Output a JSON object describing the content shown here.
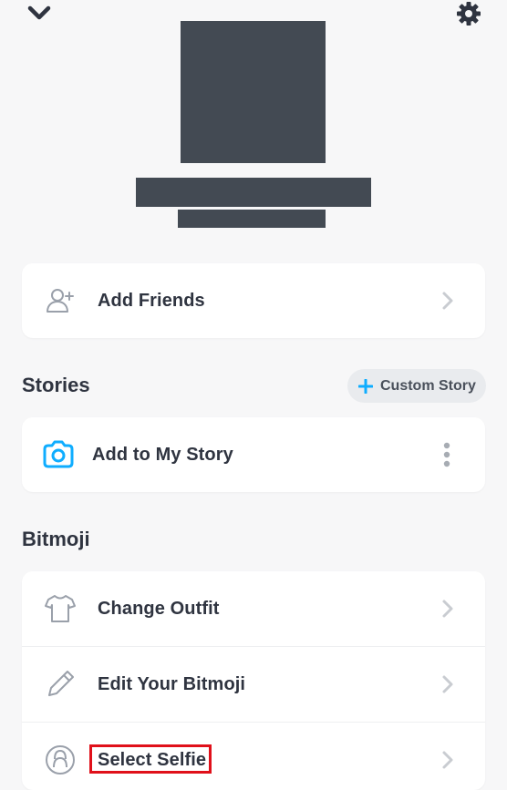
{
  "profile": {
    "avatar": "redacted",
    "display_name": "redacted",
    "username": "redacted"
  },
  "header": {
    "back_icon": "chevron-down-icon",
    "settings_icon": "gear-icon"
  },
  "friends_section": {
    "add_friends_label": "Add Friends",
    "icon": "add-friend-icon"
  },
  "stories": {
    "title": "Stories",
    "custom_story_label": "Custom Story",
    "add_to_story_label": "Add to My Story",
    "camera_icon": "camera-icon",
    "more_icon": "more-vertical-icon",
    "accent_color": "#0fadff"
  },
  "bitmoji": {
    "title": "Bitmoji",
    "items": [
      {
        "label": "Change Outfit",
        "icon": "tshirt-icon"
      },
      {
        "label": "Edit Your Bitmoji",
        "icon": "pencil-icon"
      },
      {
        "label": "Select Selfie",
        "icon": "selfie-icon"
      }
    ]
  },
  "annotation": {
    "highlight_color": "#e0101a",
    "target": "Select Selfie"
  }
}
